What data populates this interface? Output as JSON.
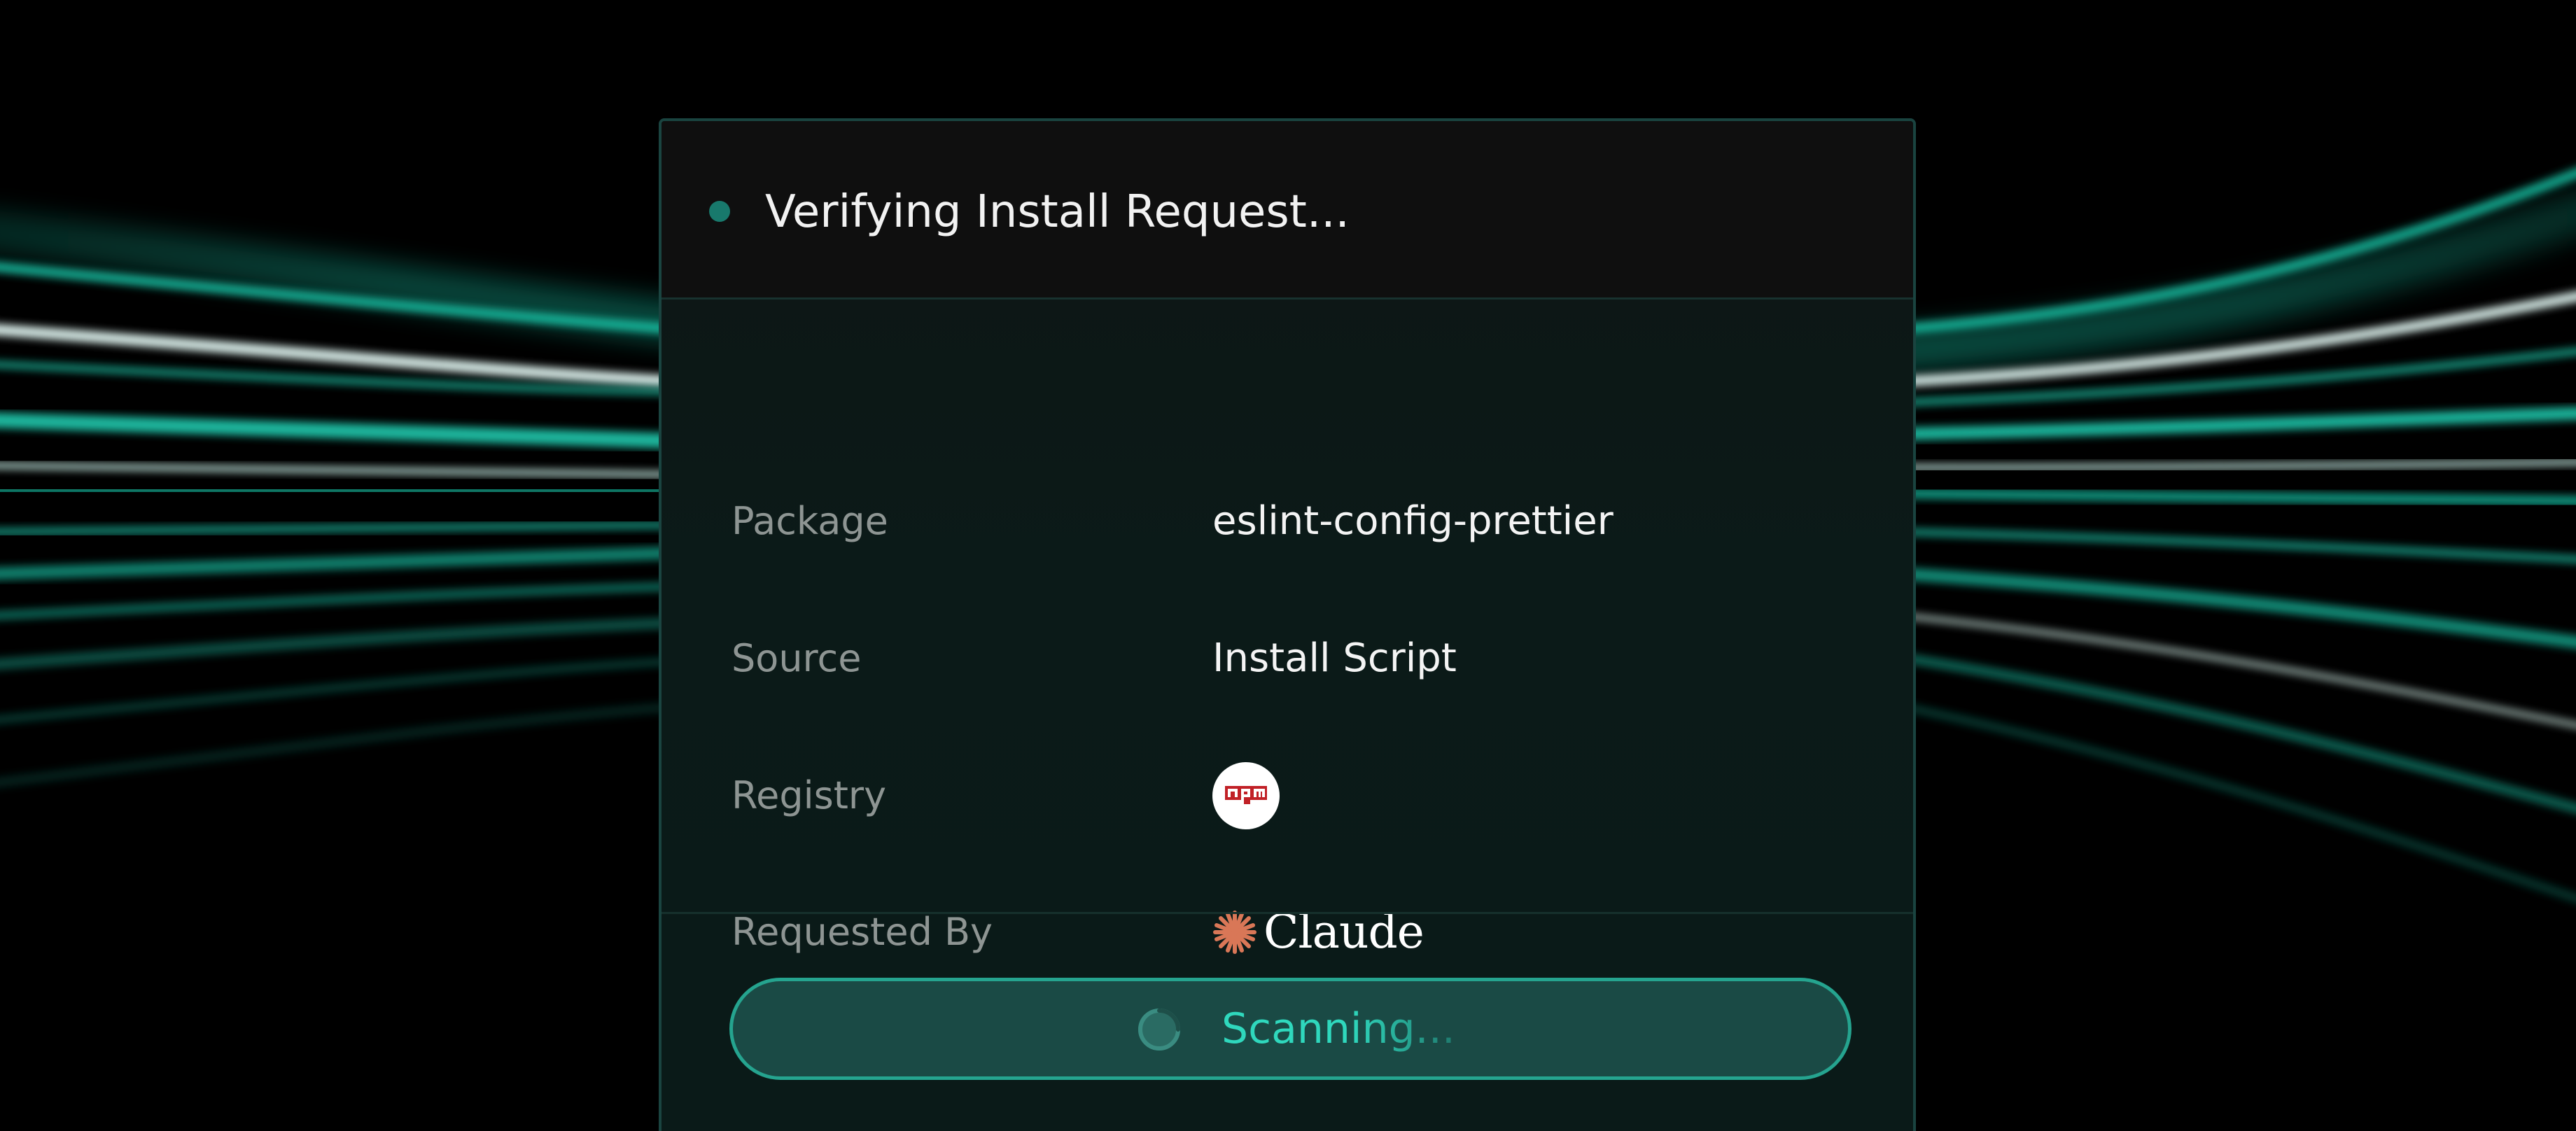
{
  "colors": {
    "accent": "#2fd8bd",
    "status_dot": "#18796c",
    "button_fill": "#1a4a45",
    "button_border": "#25a48f",
    "label_text": "#8e9593",
    "value_text": "#f4f4f4",
    "npm_red": "#c12127",
    "claude_orange": "#d97757"
  },
  "dialog": {
    "title": "Verifying Install Request...",
    "status_icon": "status-dot-icon"
  },
  "details": [
    {
      "label": "Package",
      "value": "eslint-config-prettier"
    },
    {
      "label": "Source",
      "value": "Install Script"
    },
    {
      "label": "Registry",
      "value": "",
      "icon": "npm-logo-icon",
      "logo_text": "npm"
    },
    {
      "label": "Requested By",
      "value": "Claude",
      "icon": "claude-logo-icon"
    }
  ],
  "action": {
    "label": "Scanning...",
    "icon": "spinner-icon"
  }
}
